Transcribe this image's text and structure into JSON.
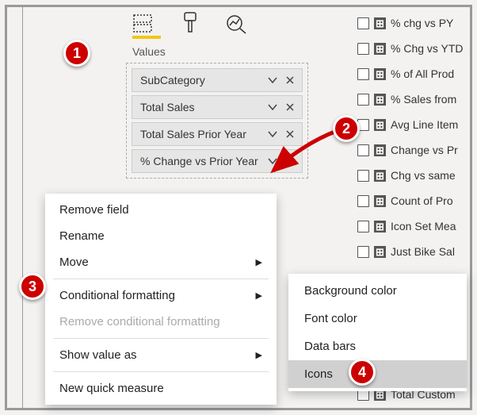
{
  "section_label": "Values",
  "badges": {
    "b1": "1",
    "b2": "2",
    "b3": "3",
    "b4": "4"
  },
  "pills": [
    {
      "label": "SubCategory"
    },
    {
      "label": "Total Sales"
    },
    {
      "label": "Total Sales Prior Year"
    },
    {
      "label": "% Change vs Prior Year"
    }
  ],
  "ctx": {
    "remove_field": "Remove field",
    "rename": "Rename",
    "move": "Move",
    "conditional_formatting": "Conditional formatting",
    "remove_conditional_formatting": "Remove conditional formatting",
    "show_value_as": "Show value as",
    "new_quick_measure": "New quick measure"
  },
  "submenu": {
    "background_color": "Background color",
    "font_color": "Font color",
    "data_bars": "Data bars",
    "icons": "Icons"
  },
  "fields": [
    "% chg vs PY",
    "% Chg vs YTD",
    "% of All Prod",
    "% Sales from",
    "Avg Line Item",
    "Change vs Pr",
    "Chg vs same",
    "Count of Pro",
    "Icon Set Mea",
    "Just Bike Sal",
    "Total Custom"
  ]
}
